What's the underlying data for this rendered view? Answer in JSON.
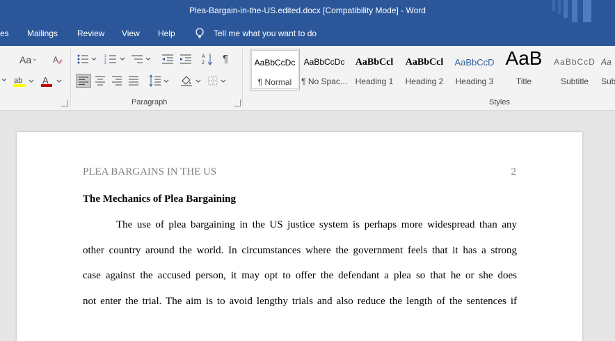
{
  "window": {
    "title": "Plea-Bargain-in-the-US.edited.docx [Compatibility Mode]  -  Word"
  },
  "menu": {
    "items": [
      "es",
      "Mailings",
      "Review",
      "View",
      "Help"
    ],
    "tell_me": "Tell me what you want to do"
  },
  "ribbon": {
    "font_size_label": "Aa",
    "paragraph_label": "Paragraph",
    "styles_label": "Styles",
    "styles": [
      {
        "preview": "AaBbCcDc",
        "name": "¶ Normal"
      },
      {
        "preview": "AaBbCcDc",
        "name": "¶ No Spac..."
      },
      {
        "preview": "AaBbCcl",
        "name": "Heading 1"
      },
      {
        "preview": "AaBbCcl",
        "name": "Heading 2"
      },
      {
        "preview": "AaBbCcD",
        "name": "Heading 3"
      },
      {
        "preview": "AaB",
        "name": "Title"
      },
      {
        "preview": "AaBbCcD",
        "name": "Subtitle"
      },
      {
        "preview": "Aa",
        "name": "Sub"
      }
    ],
    "colors": {
      "highlight": "#ffff00",
      "font_color": "#c00000",
      "accent": "#2b579a"
    }
  },
  "document": {
    "running_head": "PLEA BARGAINS IN THE US",
    "page_number": "2",
    "heading": "The Mechanics of Plea Bargaining",
    "lines": [
      "The use of plea bargaining in the US justice system is perhaps more widespread than any",
      "other country around the world. In circumstances where the government feels that it has a strong",
      "case against the accused person, it may opt to offer the defendant a plea so that he or she does",
      "not enter the trial. The aim is to avoid lengthy trials and also reduce the length of the sentences if"
    ]
  }
}
